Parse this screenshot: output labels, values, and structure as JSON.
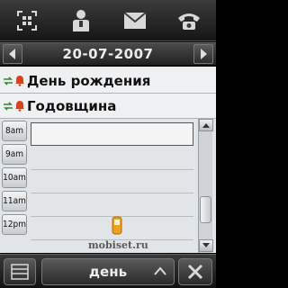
{
  "toolbar": {
    "items": [
      {
        "icon": "scan-grid-icon"
      },
      {
        "icon": "contact-icon"
      },
      {
        "icon": "envelope-icon"
      },
      {
        "icon": "phone-icon"
      }
    ]
  },
  "datebar": {
    "date": "20-07-2007"
  },
  "events": [
    {
      "title": "День рождения"
    },
    {
      "title": "Годовщина"
    }
  ],
  "times": [
    "8am",
    "9am",
    "10am",
    "11am",
    "12pm"
  ],
  "watermark": {
    "text": "mobiset.ru"
  },
  "bottombar": {
    "view_label": "день"
  },
  "colors": {
    "alarm": "#d9411e",
    "repeat": "#2e8b2e",
    "accent_logo": "#f0a020"
  }
}
